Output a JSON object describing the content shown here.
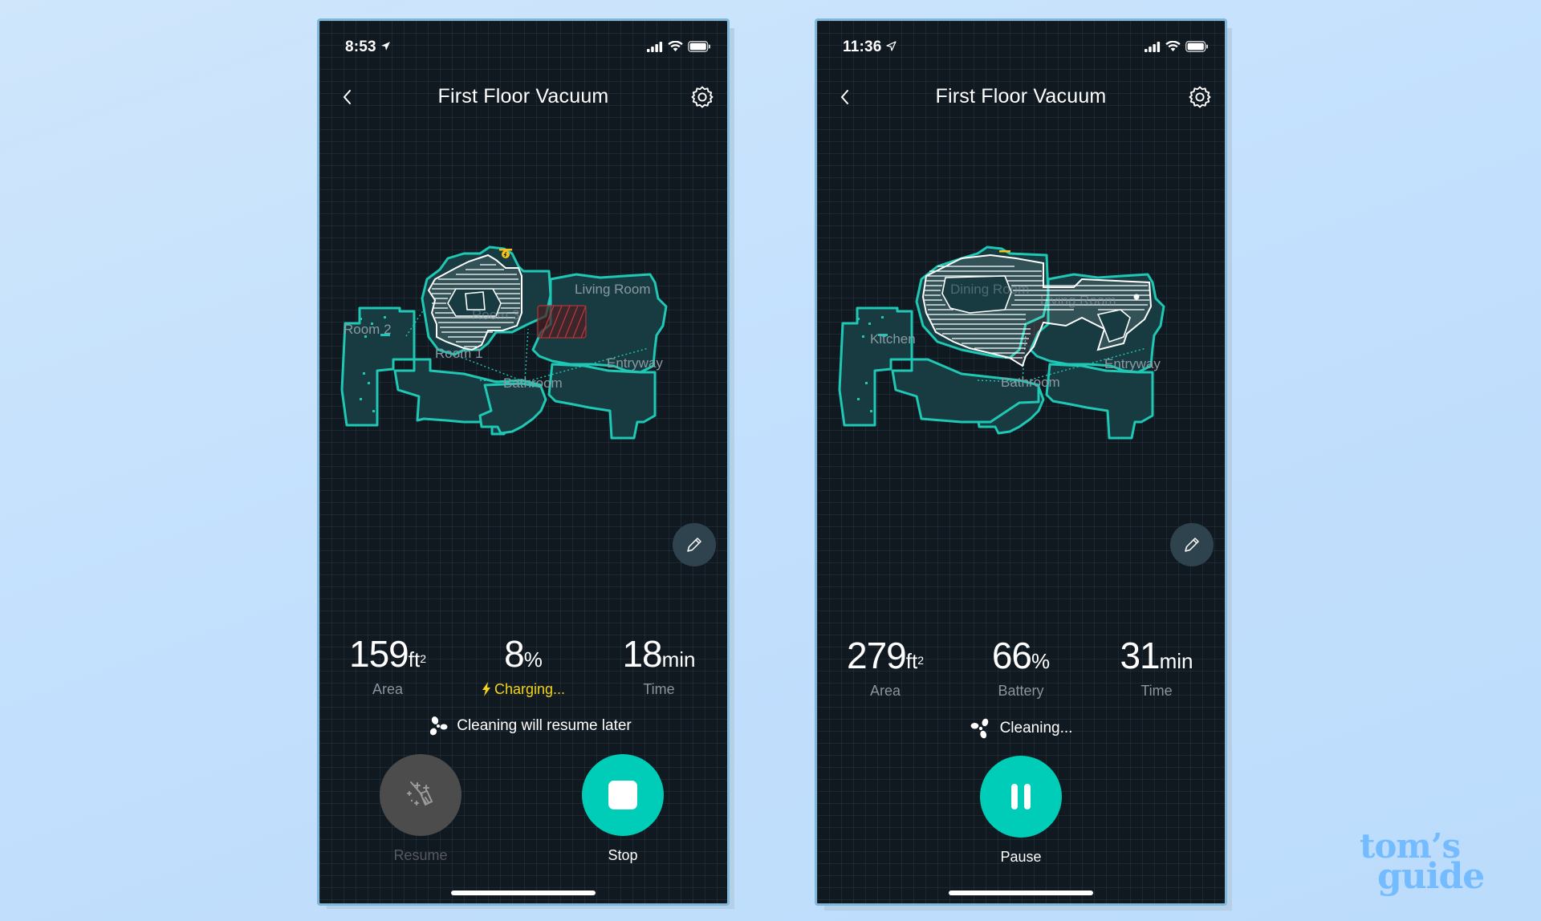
{
  "brand": {
    "watermark_line1": "tom’s",
    "watermark_line2": "guide",
    "watermark_color": "#74bcff"
  },
  "colors": {
    "accent": "#00cdb8",
    "charging": "#f3d51a",
    "map_wall": "#1fc8b4",
    "background_app": "#101820"
  },
  "phones": [
    {
      "status_bar": {
        "time": "8:53",
        "location_icon": "location-arrow-filled-icon",
        "signal_icon": "cellular-signal-icon",
        "wifi_icon": "wifi-icon",
        "battery_icon": "battery-icon"
      },
      "header": {
        "title": "First Floor Vacuum",
        "back_icon": "chevron-left-icon",
        "settings_icon": "gear-icon"
      },
      "map": {
        "rooms": [
          "Room 3",
          "Room 2",
          "Room 1",
          "Living Room",
          "Entryway",
          "Bathroom"
        ],
        "dock_icon": "charging-dock-icon",
        "no_go_zone": true,
        "edit_icon": "pencil-icon"
      },
      "stats": [
        {
          "value": "159",
          "unit": "ft",
          "unit_sup": "2",
          "label": "Area"
        },
        {
          "value": "8",
          "unit": "%",
          "unit_sup": "",
          "label": "Charging...",
          "label_icon": "lightning-bolt-icon",
          "highlight": true
        },
        {
          "value": "18",
          "unit": "min",
          "unit_sup": "",
          "label": "Time"
        }
      ],
      "status_text": "Cleaning will resume later",
      "status_icon": "fan-icon",
      "buttons": [
        {
          "label": "Resume",
          "icon": "broom-sparkle-icon",
          "enabled": false
        },
        {
          "label": "Stop",
          "icon": "stop-icon",
          "enabled": true
        }
      ]
    },
    {
      "status_bar": {
        "time": "11:36",
        "location_icon": "location-arrow-outline-icon",
        "signal_icon": "cellular-signal-icon",
        "wifi_icon": "wifi-icon",
        "battery_icon": "battery-icon"
      },
      "header": {
        "title": "First Floor Vacuum",
        "back_icon": "chevron-left-icon",
        "settings_icon": "gear-icon"
      },
      "map": {
        "rooms": [
          "Dining Room",
          "Kitchen",
          "Living Room",
          "Entryway",
          "Bathroom"
        ],
        "dock_icon": "charging-dock-icon",
        "no_go_zone": false,
        "edit_icon": "pencil-icon"
      },
      "stats": [
        {
          "value": "279",
          "unit": "ft",
          "unit_sup": "2",
          "label": "Area"
        },
        {
          "value": "66",
          "unit": "%",
          "unit_sup": "",
          "label": "Battery"
        },
        {
          "value": "31",
          "unit": "min",
          "unit_sup": "",
          "label": "Time"
        }
      ],
      "status_text": "Cleaning...",
      "status_icon": "fan-icon",
      "buttons": [
        {
          "label": "Pause",
          "icon": "pause-icon",
          "enabled": true
        }
      ]
    }
  ]
}
